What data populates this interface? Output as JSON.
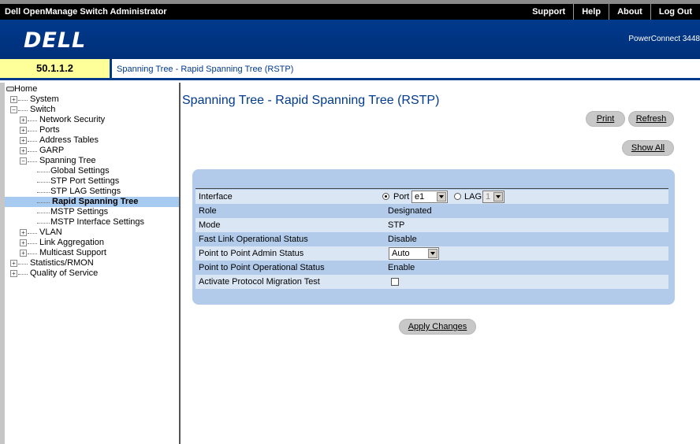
{
  "topbar": {
    "app_title": "Dell OpenManage Switch Administrator",
    "menu": [
      "Support",
      "Help",
      "About",
      "Log Out"
    ]
  },
  "brand": {
    "logo": "D&#8203;ELL",
    "logo_text": "DELL",
    "model": "PowerConnect 3448"
  },
  "ipbar": {
    "ip": "50.1.1.2",
    "breadcrumb": "Spanning Tree - Rapid Spanning Tree (RSTP)"
  },
  "tree": [
    {
      "label": "Home",
      "depth": 0,
      "type": "home"
    },
    {
      "label": "System",
      "depth": 1,
      "type": "plus"
    },
    {
      "label": "Switch",
      "depth": 1,
      "type": "minus"
    },
    {
      "label": "Network Security",
      "depth": 2,
      "type": "plus"
    },
    {
      "label": "Ports",
      "depth": 2,
      "type": "plus"
    },
    {
      "label": "Address Tables",
      "depth": 2,
      "type": "plus"
    },
    {
      "label": "GARP",
      "depth": 2,
      "type": "plus"
    },
    {
      "label": "Spanning Tree",
      "depth": 2,
      "type": "minus"
    },
    {
      "label": "Global Settings",
      "depth": 3,
      "type": "leaf"
    },
    {
      "label": "STP Port Settings",
      "depth": 3,
      "type": "leaf"
    },
    {
      "label": "STP LAG Settings",
      "depth": 3,
      "type": "leaf"
    },
    {
      "label": "Rapid Spanning Tree",
      "depth": 3,
      "type": "leaf",
      "selected": true
    },
    {
      "label": "MSTP Settings",
      "depth": 3,
      "type": "leaf"
    },
    {
      "label": "MSTP Interface Settings",
      "depth": 3,
      "type": "leaf"
    },
    {
      "label": "VLAN",
      "depth": 2,
      "type": "plus"
    },
    {
      "label": "Link Aggregation",
      "depth": 2,
      "type": "plus"
    },
    {
      "label": "Multicast Support",
      "depth": 2,
      "type": "plus"
    },
    {
      "label": "Statistics/RMON",
      "depth": 1,
      "type": "plus"
    },
    {
      "label": "Quality of Service",
      "depth": 1,
      "type": "plus"
    }
  ],
  "main": {
    "title": "Spanning Tree - Rapid Spanning Tree (RSTP)",
    "print_label": "Print",
    "refresh_label": "Refresh",
    "show_all_label": "Show All",
    "apply_label": "Apply Changes"
  },
  "form": {
    "interface_label": "Interface",
    "port_radio_label": "Port",
    "port_value": "e1",
    "lag_radio_label": "LAG",
    "lag_value": "1",
    "rows": [
      {
        "label": "Role",
        "value": "Designated"
      },
      {
        "label": "Mode",
        "value": "STP"
      },
      {
        "label": "Fast Link Operational Status",
        "value": "Disable"
      },
      {
        "label": "Point to Point Admin Status",
        "value": ""
      },
      {
        "label": "Point to Point Operational Status",
        "value": "Enable"
      },
      {
        "label": "Activate Protocol Migration Test",
        "value": ""
      }
    ],
    "p2p_admin_value": "Auto"
  },
  "colors": {
    "brand_blue": "#003a8c",
    "panel_bg": "#b3cbea",
    "selected_bg": "#a6caf0",
    "ip_bg": "#ffff99"
  }
}
